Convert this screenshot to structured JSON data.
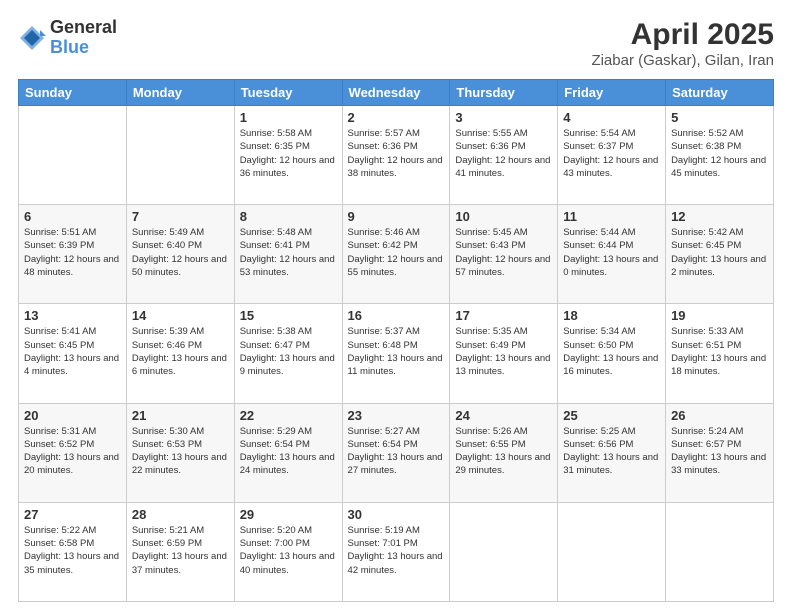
{
  "header": {
    "logo_general": "General",
    "logo_blue": "Blue",
    "title": "April 2025",
    "subtitle": "Ziabar (Gaskar), Gilan, Iran"
  },
  "weekdays": [
    "Sunday",
    "Monday",
    "Tuesday",
    "Wednesday",
    "Thursday",
    "Friday",
    "Saturday"
  ],
  "weeks": [
    [
      {
        "day": "",
        "info": ""
      },
      {
        "day": "",
        "info": ""
      },
      {
        "day": "1",
        "info": "Sunrise: 5:58 AM\nSunset: 6:35 PM\nDaylight: 12 hours and 36 minutes."
      },
      {
        "day": "2",
        "info": "Sunrise: 5:57 AM\nSunset: 6:36 PM\nDaylight: 12 hours and 38 minutes."
      },
      {
        "day": "3",
        "info": "Sunrise: 5:55 AM\nSunset: 6:36 PM\nDaylight: 12 hours and 41 minutes."
      },
      {
        "day": "4",
        "info": "Sunrise: 5:54 AM\nSunset: 6:37 PM\nDaylight: 12 hours and 43 minutes."
      },
      {
        "day": "5",
        "info": "Sunrise: 5:52 AM\nSunset: 6:38 PM\nDaylight: 12 hours and 45 minutes."
      }
    ],
    [
      {
        "day": "6",
        "info": "Sunrise: 5:51 AM\nSunset: 6:39 PM\nDaylight: 12 hours and 48 minutes."
      },
      {
        "day": "7",
        "info": "Sunrise: 5:49 AM\nSunset: 6:40 PM\nDaylight: 12 hours and 50 minutes."
      },
      {
        "day": "8",
        "info": "Sunrise: 5:48 AM\nSunset: 6:41 PM\nDaylight: 12 hours and 53 minutes."
      },
      {
        "day": "9",
        "info": "Sunrise: 5:46 AM\nSunset: 6:42 PM\nDaylight: 12 hours and 55 minutes."
      },
      {
        "day": "10",
        "info": "Sunrise: 5:45 AM\nSunset: 6:43 PM\nDaylight: 12 hours and 57 minutes."
      },
      {
        "day": "11",
        "info": "Sunrise: 5:44 AM\nSunset: 6:44 PM\nDaylight: 13 hours and 0 minutes."
      },
      {
        "day": "12",
        "info": "Sunrise: 5:42 AM\nSunset: 6:45 PM\nDaylight: 13 hours and 2 minutes."
      }
    ],
    [
      {
        "day": "13",
        "info": "Sunrise: 5:41 AM\nSunset: 6:45 PM\nDaylight: 13 hours and 4 minutes."
      },
      {
        "day": "14",
        "info": "Sunrise: 5:39 AM\nSunset: 6:46 PM\nDaylight: 13 hours and 6 minutes."
      },
      {
        "day": "15",
        "info": "Sunrise: 5:38 AM\nSunset: 6:47 PM\nDaylight: 13 hours and 9 minutes."
      },
      {
        "day": "16",
        "info": "Sunrise: 5:37 AM\nSunset: 6:48 PM\nDaylight: 13 hours and 11 minutes."
      },
      {
        "day": "17",
        "info": "Sunrise: 5:35 AM\nSunset: 6:49 PM\nDaylight: 13 hours and 13 minutes."
      },
      {
        "day": "18",
        "info": "Sunrise: 5:34 AM\nSunset: 6:50 PM\nDaylight: 13 hours and 16 minutes."
      },
      {
        "day": "19",
        "info": "Sunrise: 5:33 AM\nSunset: 6:51 PM\nDaylight: 13 hours and 18 minutes."
      }
    ],
    [
      {
        "day": "20",
        "info": "Sunrise: 5:31 AM\nSunset: 6:52 PM\nDaylight: 13 hours and 20 minutes."
      },
      {
        "day": "21",
        "info": "Sunrise: 5:30 AM\nSunset: 6:53 PM\nDaylight: 13 hours and 22 minutes."
      },
      {
        "day": "22",
        "info": "Sunrise: 5:29 AM\nSunset: 6:54 PM\nDaylight: 13 hours and 24 minutes."
      },
      {
        "day": "23",
        "info": "Sunrise: 5:27 AM\nSunset: 6:54 PM\nDaylight: 13 hours and 27 minutes."
      },
      {
        "day": "24",
        "info": "Sunrise: 5:26 AM\nSunset: 6:55 PM\nDaylight: 13 hours and 29 minutes."
      },
      {
        "day": "25",
        "info": "Sunrise: 5:25 AM\nSunset: 6:56 PM\nDaylight: 13 hours and 31 minutes."
      },
      {
        "day": "26",
        "info": "Sunrise: 5:24 AM\nSunset: 6:57 PM\nDaylight: 13 hours and 33 minutes."
      }
    ],
    [
      {
        "day": "27",
        "info": "Sunrise: 5:22 AM\nSunset: 6:58 PM\nDaylight: 13 hours and 35 minutes."
      },
      {
        "day": "28",
        "info": "Sunrise: 5:21 AM\nSunset: 6:59 PM\nDaylight: 13 hours and 37 minutes."
      },
      {
        "day": "29",
        "info": "Sunrise: 5:20 AM\nSunset: 7:00 PM\nDaylight: 13 hours and 40 minutes."
      },
      {
        "day": "30",
        "info": "Sunrise: 5:19 AM\nSunset: 7:01 PM\nDaylight: 13 hours and 42 minutes."
      },
      {
        "day": "",
        "info": ""
      },
      {
        "day": "",
        "info": ""
      },
      {
        "day": "",
        "info": ""
      }
    ]
  ]
}
